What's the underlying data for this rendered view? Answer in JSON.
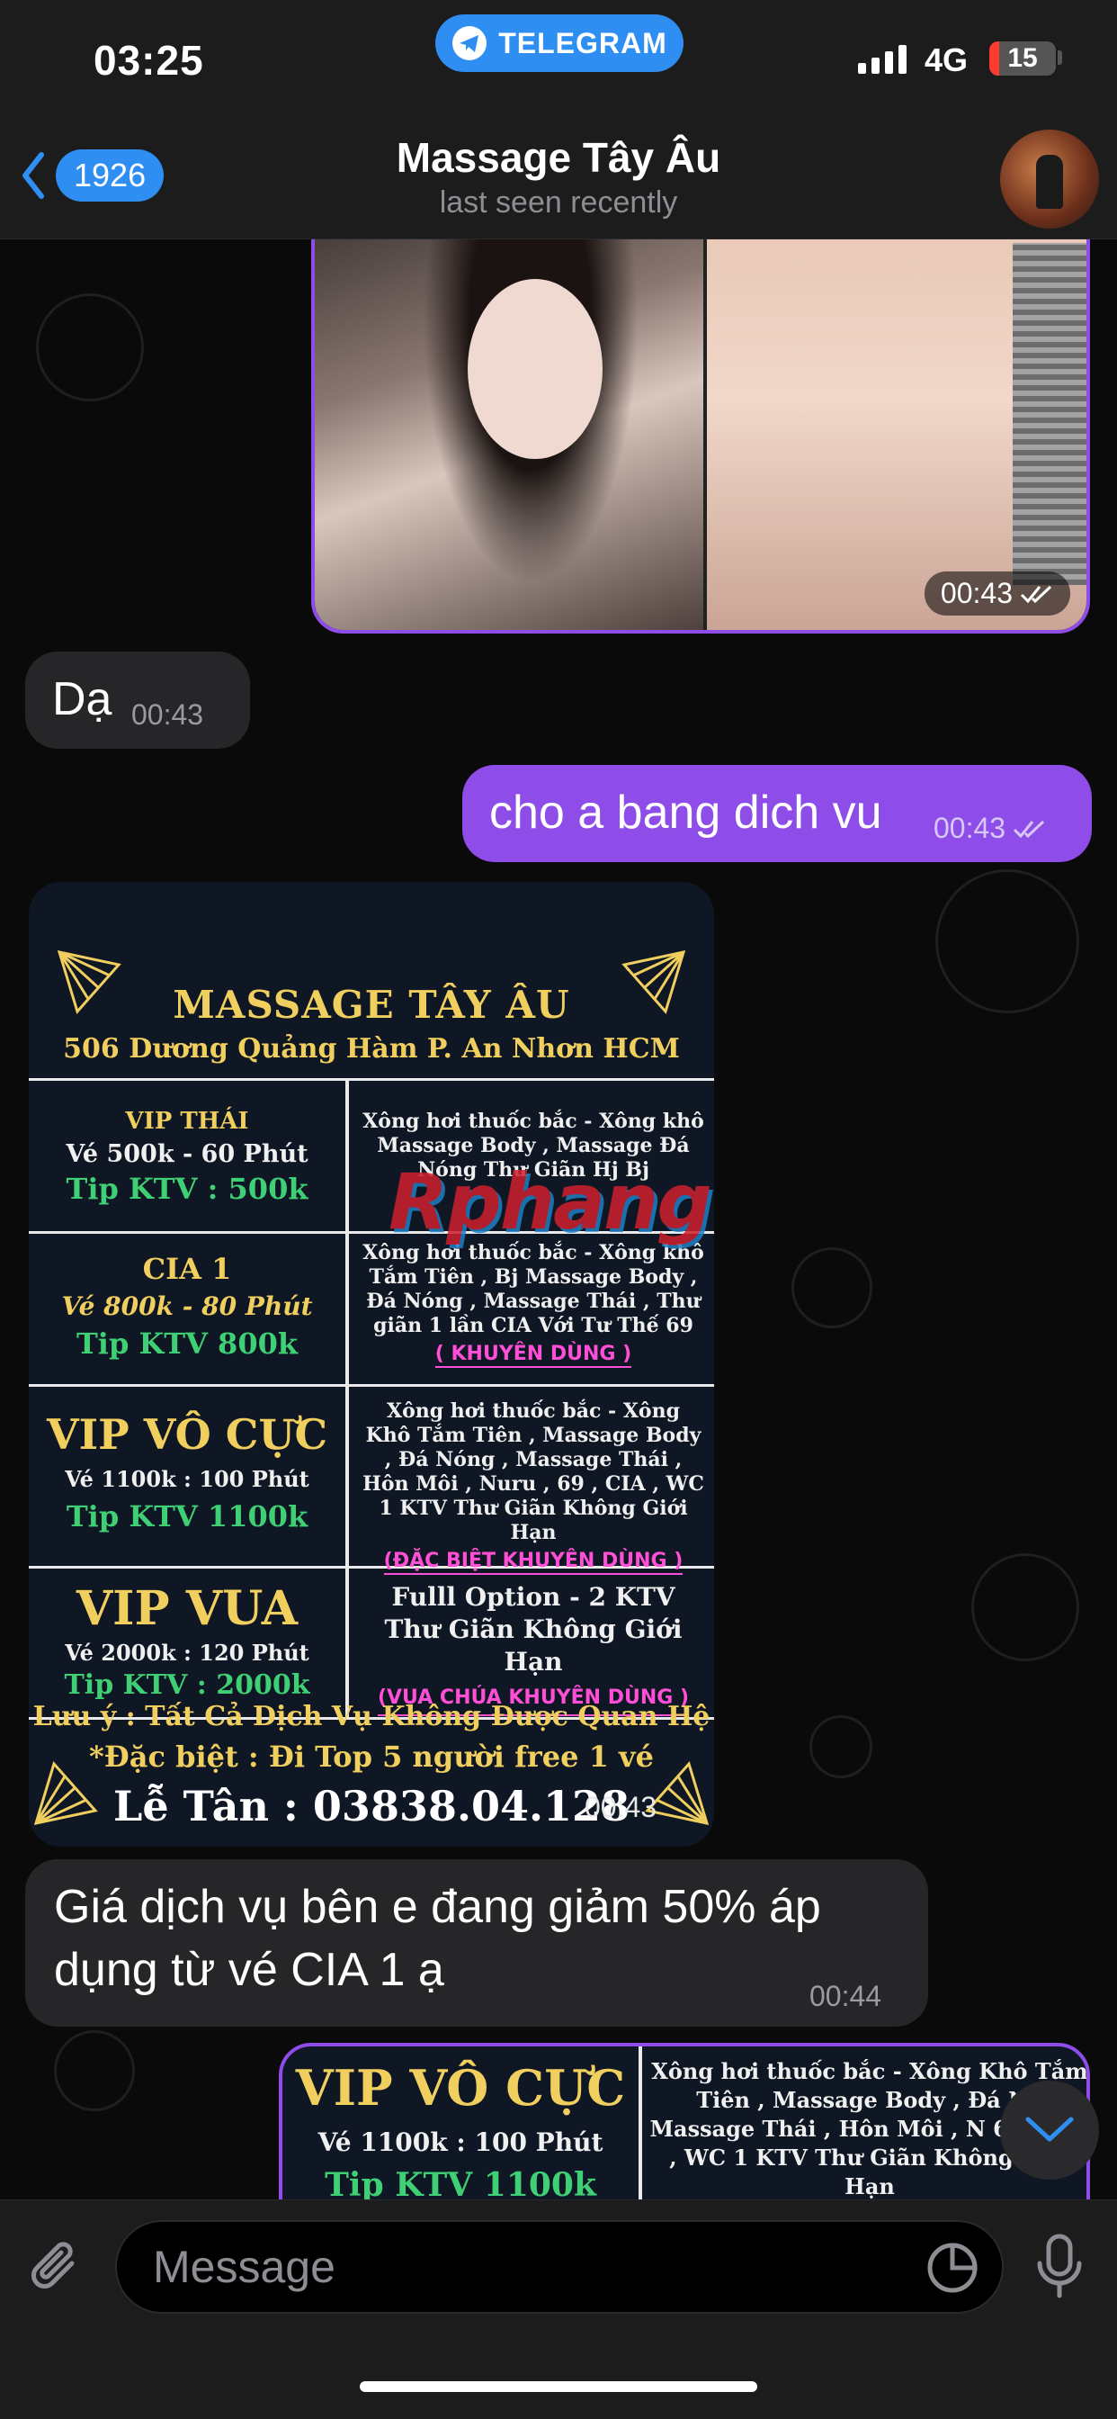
{
  "status_bar": {
    "time": "03:25",
    "app_pill": "TELEGRAM",
    "network": "4G",
    "battery": "15",
    "battery_level": 0.15
  },
  "nav": {
    "back_count": "1926",
    "title": "Massage Tây Âu",
    "subtitle": "last seen recently"
  },
  "messages": {
    "media_time": "00:43",
    "m1": {
      "text": "Dạ",
      "time": "00:43"
    },
    "m2": {
      "text": "cho a bang dich vu",
      "time": "00:43"
    },
    "poster_time": "00:43",
    "m3": {
      "text": "Giá dịch vụ bên e đang giảm 50% áp dụng từ vé CIA 1 ạ",
      "time": "00:44"
    }
  },
  "poster": {
    "title": "MASSAGE TÂY ÂU",
    "address": "506 Dương Quảng Hàm P. An Nhơn HCM",
    "packages": [
      {
        "name": "VIP THÁI",
        "price": "Vé 500k - 60 Phút",
        "tip": "Tip KTV : 500k",
        "services": "Xông hơi thuốc bắc - Xông khô Massage Body , Massage Đá Nóng Thư Giãn Hj Bj",
        "tag": ""
      },
      {
        "name": "CIA 1",
        "price": "Vé 800k - 80 Phút",
        "tip": "Tip KTV 800k",
        "services": "Xông hơi thuốc bắc - Xông khô Tắm Tiên , Bj Massage Body , Đá Nóng , Massage Thái , Thư giãn 1 lần CIA Với Tư Thế 69",
        "tag": "( KHUYÊN DÙNG )"
      },
      {
        "name": "VIP VÔ CỰC",
        "price": "Vé 1100k : 100 Phút",
        "tip": "Tip KTV 1100k",
        "services": "Xông hơi thuốc bắc - Xông Khô Tắm Tiên , Massage Body , Đá Nóng , Massage Thái , Hôn Môi , Nuru , 69 , CIA , WC 1 KTV Thư Giãn Không Giới Hạn",
        "tag": "(ĐẶC BIỆT KHUYÊN DÙNG )"
      },
      {
        "name": "VIP VUA",
        "price": "Vé 2000k : 120 Phút",
        "tip": "Tip KTV : 2000k",
        "services": "Fulll Option - 2 KTV Thư Giãn Không Giới Hạn",
        "tag": "(VUA CHÚA KHUYÊN DÙNG )"
      }
    ],
    "note1": "Lưu ý : Tất Cả Dịch Vụ Không Được Quan Hệ",
    "note2": "*Đặc biệt : Đi Top 5 người free 1 vé",
    "phone": "Lễ Tân : 03838.04.128",
    "watermark": "Rphang"
  },
  "poster2": {
    "name": "VIP VÔ CỰC",
    "price": "Vé 1100k : 100 Phút",
    "tip": "Tip KTV 1100k",
    "services": "Xông hơi thuốc bắc - Xông Khô Tắm Tiên , Massage Body , Đá N , Massage Thái , Hôn Môi , N 69 , CIA , WC 1 KTV Thư Giãn Không Giới Hạn"
  },
  "composer": {
    "placeholder": "Message"
  },
  "icons": {
    "back": "chevron-left-icon",
    "telegram": "telegram-plane-icon",
    "attach": "paperclip-icon",
    "sticker": "sticker-icon",
    "mic": "microphone-icon",
    "scroll": "chevron-down-icon",
    "read": "double-check-icon"
  },
  "colors": {
    "accent": "#2f8ef2",
    "outgoing": "#8e4ce8",
    "incoming": "#262628",
    "poster_gold": "#f1cf5e",
    "poster_green": "#3fcf74",
    "poster_pink": "#ff4fd6"
  }
}
